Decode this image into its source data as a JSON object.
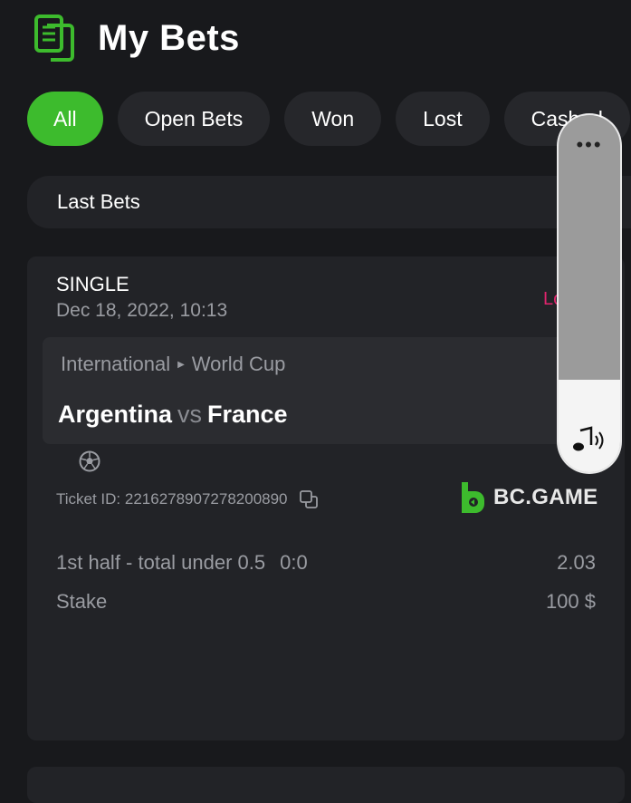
{
  "header": {
    "title": "My Bets",
    "icon": "bets-document-icon"
  },
  "tabs": [
    {
      "label": "All",
      "active": true
    },
    {
      "label": "Open Bets",
      "active": false
    },
    {
      "label": "Won",
      "active": false
    },
    {
      "label": "Lost",
      "active": false
    },
    {
      "label": "Cashed",
      "active": false
    }
  ],
  "section": {
    "title": "Last Bets"
  },
  "bet": {
    "type": "SINGLE",
    "date": "Dec 18, 2022, 10:13",
    "status": "Lo",
    "league": "International",
    "tournament": "World Cup",
    "home": "Argentina",
    "vs": "vs",
    "away": "France",
    "ticket_label": "Ticket ID: 221627890727820089​0",
    "brand": "BC.GAME",
    "market": "1st half - total under 0.5",
    "score": "0:0",
    "odds": "2.03",
    "stake_label": "Stake",
    "stake_value": "100 $"
  },
  "volume_overlay": {
    "menu": "•••",
    "level": 0.26
  },
  "colors": {
    "accent": "#3dbb2d",
    "status_lost": "#e0246d",
    "background": "#18191c",
    "card": "#222327"
  }
}
